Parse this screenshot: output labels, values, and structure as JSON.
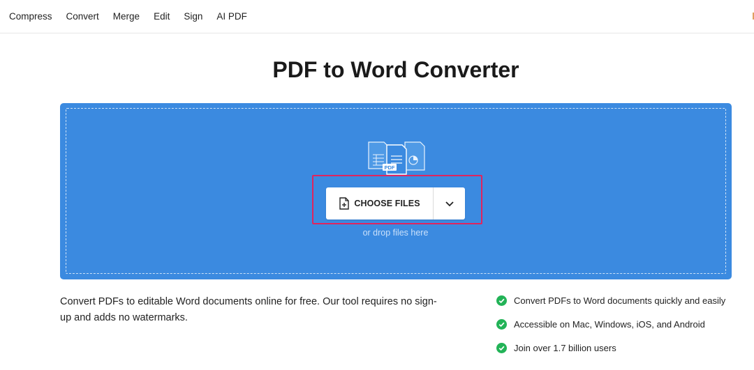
{
  "nav": {
    "items": [
      {
        "label": "Compress"
      },
      {
        "label": "Convert"
      },
      {
        "label": "Merge"
      },
      {
        "label": "Edit"
      },
      {
        "label": "Sign"
      },
      {
        "label": "AI PDF"
      }
    ]
  },
  "page": {
    "title": "PDF to Word Converter"
  },
  "upload": {
    "choose_label": "CHOOSE FILES",
    "drop_hint": "or drop files here",
    "illustration_badge": "PDF",
    "choose_icon": "file-plus-icon",
    "dropdown_icon": "chevron-down-icon"
  },
  "intro": {
    "text": "Convert PDFs to editable Word documents online for free. Our tool requires no sign-up and adds no watermarks."
  },
  "features": [
    {
      "label": "Convert PDFs to Word documents quickly and easily"
    },
    {
      "label": "Accessible on Mac, Windows, iOS, and Android"
    },
    {
      "label": "Join over 1.7 billion users"
    }
  ],
  "colors": {
    "dropzone": "#3b8ae0",
    "highlight": "#e0245e",
    "check": "#22b357"
  }
}
